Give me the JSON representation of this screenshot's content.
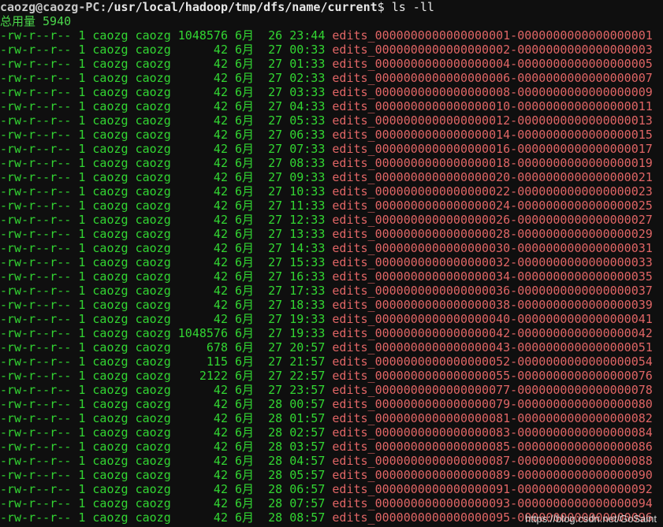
{
  "prompt": {
    "user_host": "caozg@caozg-PC",
    "sep": ":",
    "path": "/usr/local/hadoop/tmp/dfs/name/current",
    "symbol": "$",
    "command": "ls -ll"
  },
  "total": "总用量 5940",
  "colors": {
    "background": "#0f0f0f",
    "listing_fields": "#32d632",
    "filename": "#e06565",
    "prompt": "#c8c8c8"
  },
  "rows": [
    {
      "perm": "-rw-r--r--",
      "links": "1",
      "owner": "caozg",
      "group": "caozg",
      "size": "1048576",
      "month": "6月",
      "day": "26",
      "time": "23:44",
      "name": "edits_0000000000000000001-0000000000000000001"
    },
    {
      "perm": "-rw-r--r--",
      "links": "1",
      "owner": "caozg",
      "group": "caozg",
      "size": "42",
      "month": "6月",
      "day": "27",
      "time": "00:33",
      "name": "edits_0000000000000000002-0000000000000000003"
    },
    {
      "perm": "-rw-r--r--",
      "links": "1",
      "owner": "caozg",
      "group": "caozg",
      "size": "42",
      "month": "6月",
      "day": "27",
      "time": "01:33",
      "name": "edits_0000000000000000004-0000000000000000005"
    },
    {
      "perm": "-rw-r--r--",
      "links": "1",
      "owner": "caozg",
      "group": "caozg",
      "size": "42",
      "month": "6月",
      "day": "27",
      "time": "02:33",
      "name": "edits_0000000000000000006-0000000000000000007"
    },
    {
      "perm": "-rw-r--r--",
      "links": "1",
      "owner": "caozg",
      "group": "caozg",
      "size": "42",
      "month": "6月",
      "day": "27",
      "time": "03:33",
      "name": "edits_0000000000000000008-0000000000000000009"
    },
    {
      "perm": "-rw-r--r--",
      "links": "1",
      "owner": "caozg",
      "group": "caozg",
      "size": "42",
      "month": "6月",
      "day": "27",
      "time": "04:33",
      "name": "edits_0000000000000000010-0000000000000000011"
    },
    {
      "perm": "-rw-r--r--",
      "links": "1",
      "owner": "caozg",
      "group": "caozg",
      "size": "42",
      "month": "6月",
      "day": "27",
      "time": "05:33",
      "name": "edits_0000000000000000012-0000000000000000013"
    },
    {
      "perm": "-rw-r--r--",
      "links": "1",
      "owner": "caozg",
      "group": "caozg",
      "size": "42",
      "month": "6月",
      "day": "27",
      "time": "06:33",
      "name": "edits_0000000000000000014-0000000000000000015"
    },
    {
      "perm": "-rw-r--r--",
      "links": "1",
      "owner": "caozg",
      "group": "caozg",
      "size": "42",
      "month": "6月",
      "day": "27",
      "time": "07:33",
      "name": "edits_0000000000000000016-0000000000000000017"
    },
    {
      "perm": "-rw-r--r--",
      "links": "1",
      "owner": "caozg",
      "group": "caozg",
      "size": "42",
      "month": "6月",
      "day": "27",
      "time": "08:33",
      "name": "edits_0000000000000000018-0000000000000000019"
    },
    {
      "perm": "-rw-r--r--",
      "links": "1",
      "owner": "caozg",
      "group": "caozg",
      "size": "42",
      "month": "6月",
      "day": "27",
      "time": "09:33",
      "name": "edits_0000000000000000020-0000000000000000021"
    },
    {
      "perm": "-rw-r--r--",
      "links": "1",
      "owner": "caozg",
      "group": "caozg",
      "size": "42",
      "month": "6月",
      "day": "27",
      "time": "10:33",
      "name": "edits_0000000000000000022-0000000000000000023"
    },
    {
      "perm": "-rw-r--r--",
      "links": "1",
      "owner": "caozg",
      "group": "caozg",
      "size": "42",
      "month": "6月",
      "day": "27",
      "time": "11:33",
      "name": "edits_0000000000000000024-0000000000000000025"
    },
    {
      "perm": "-rw-r--r--",
      "links": "1",
      "owner": "caozg",
      "group": "caozg",
      "size": "42",
      "month": "6月",
      "day": "27",
      "time": "12:33",
      "name": "edits_0000000000000000026-0000000000000000027"
    },
    {
      "perm": "-rw-r--r--",
      "links": "1",
      "owner": "caozg",
      "group": "caozg",
      "size": "42",
      "month": "6月",
      "day": "27",
      "time": "13:33",
      "name": "edits_0000000000000000028-0000000000000000029"
    },
    {
      "perm": "-rw-r--r--",
      "links": "1",
      "owner": "caozg",
      "group": "caozg",
      "size": "42",
      "month": "6月",
      "day": "27",
      "time": "14:33",
      "name": "edits_0000000000000000030-0000000000000000031"
    },
    {
      "perm": "-rw-r--r--",
      "links": "1",
      "owner": "caozg",
      "group": "caozg",
      "size": "42",
      "month": "6月",
      "day": "27",
      "time": "15:33",
      "name": "edits_0000000000000000032-0000000000000000033"
    },
    {
      "perm": "-rw-r--r--",
      "links": "1",
      "owner": "caozg",
      "group": "caozg",
      "size": "42",
      "month": "6月",
      "day": "27",
      "time": "16:33",
      "name": "edits_0000000000000000034-0000000000000000035"
    },
    {
      "perm": "-rw-r--r--",
      "links": "1",
      "owner": "caozg",
      "group": "caozg",
      "size": "42",
      "month": "6月",
      "day": "27",
      "time": "17:33",
      "name": "edits_0000000000000000036-0000000000000000037"
    },
    {
      "perm": "-rw-r--r--",
      "links": "1",
      "owner": "caozg",
      "group": "caozg",
      "size": "42",
      "month": "6月",
      "day": "27",
      "time": "18:33",
      "name": "edits_0000000000000000038-0000000000000000039"
    },
    {
      "perm": "-rw-r--r--",
      "links": "1",
      "owner": "caozg",
      "group": "caozg",
      "size": "42",
      "month": "6月",
      "day": "27",
      "time": "19:33",
      "name": "edits_0000000000000000040-0000000000000000041"
    },
    {
      "perm": "-rw-r--r--",
      "links": "1",
      "owner": "caozg",
      "group": "caozg",
      "size": "1048576",
      "month": "6月",
      "day": "27",
      "time": "19:33",
      "name": "edits_0000000000000000042-0000000000000000042"
    },
    {
      "perm": "-rw-r--r--",
      "links": "1",
      "owner": "caozg",
      "group": "caozg",
      "size": "678",
      "month": "6月",
      "day": "27",
      "time": "20:57",
      "name": "edits_0000000000000000043-0000000000000000051"
    },
    {
      "perm": "-rw-r--r--",
      "links": "1",
      "owner": "caozg",
      "group": "caozg",
      "size": "115",
      "month": "6月",
      "day": "27",
      "time": "21:57",
      "name": "edits_0000000000000000052-0000000000000000054"
    },
    {
      "perm": "-rw-r--r--",
      "links": "1",
      "owner": "caozg",
      "group": "caozg",
      "size": "2122",
      "month": "6月",
      "day": "27",
      "time": "22:57",
      "name": "edits_0000000000000000055-0000000000000000076"
    },
    {
      "perm": "-rw-r--r--",
      "links": "1",
      "owner": "caozg",
      "group": "caozg",
      "size": "42",
      "month": "6月",
      "day": "27",
      "time": "23:57",
      "name": "edits_0000000000000000077-0000000000000000078"
    },
    {
      "perm": "-rw-r--r--",
      "links": "1",
      "owner": "caozg",
      "group": "caozg",
      "size": "42",
      "month": "6月",
      "day": "28",
      "time": "00:57",
      "name": "edits_0000000000000000079-0000000000000000080"
    },
    {
      "perm": "-rw-r--r--",
      "links": "1",
      "owner": "caozg",
      "group": "caozg",
      "size": "42",
      "month": "6月",
      "day": "28",
      "time": "01:57",
      "name": "edits_0000000000000000081-0000000000000000082"
    },
    {
      "perm": "-rw-r--r--",
      "links": "1",
      "owner": "caozg",
      "group": "caozg",
      "size": "42",
      "month": "6月",
      "day": "28",
      "time": "02:57",
      "name": "edits_0000000000000000083-0000000000000000084"
    },
    {
      "perm": "-rw-r--r--",
      "links": "1",
      "owner": "caozg",
      "group": "caozg",
      "size": "42",
      "month": "6月",
      "day": "28",
      "time": "03:57",
      "name": "edits_0000000000000000085-0000000000000000086"
    },
    {
      "perm": "-rw-r--r--",
      "links": "1",
      "owner": "caozg",
      "group": "caozg",
      "size": "42",
      "month": "6月",
      "day": "28",
      "time": "04:57",
      "name": "edits_0000000000000000087-0000000000000000088"
    },
    {
      "perm": "-rw-r--r--",
      "links": "1",
      "owner": "caozg",
      "group": "caozg",
      "size": "42",
      "month": "6月",
      "day": "28",
      "time": "05:57",
      "name": "edits_0000000000000000089-0000000000000000090"
    },
    {
      "perm": "-rw-r--r--",
      "links": "1",
      "owner": "caozg",
      "group": "caozg",
      "size": "42",
      "month": "6月",
      "day": "28",
      "time": "06:57",
      "name": "edits_0000000000000000091-0000000000000000092"
    },
    {
      "perm": "-rw-r--r--",
      "links": "1",
      "owner": "caozg",
      "group": "caozg",
      "size": "42",
      "month": "6月",
      "day": "28",
      "time": "07:57",
      "name": "edits_0000000000000000093-0000000000000000094"
    },
    {
      "perm": "-rw-r--r--",
      "links": "1",
      "owner": "caozg",
      "group": "caozg",
      "size": "42",
      "month": "6月",
      "day": "28",
      "time": "08:57",
      "name": "edits_0000000000000000095-0000000000000000096"
    }
  ],
  "watermark": "https://blog.csdn.net/GoSaint"
}
